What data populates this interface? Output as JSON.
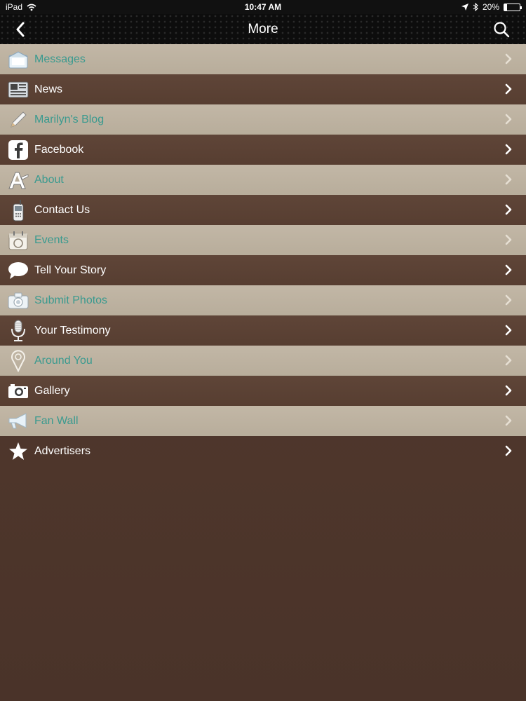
{
  "status_bar": {
    "device": "iPad",
    "time": "10:47 AM",
    "battery": "20%",
    "battery_level": 0.2
  },
  "nav": {
    "title": "More"
  },
  "menu": [
    {
      "label": "Messages",
      "icon": "envelope-icon"
    },
    {
      "label": "News",
      "icon": "newspaper-icon"
    },
    {
      "label": "Marilyn's Blog",
      "icon": "pencil-icon"
    },
    {
      "label": "Facebook",
      "icon": "facebook-icon"
    },
    {
      "label": "About",
      "icon": "about-icon"
    },
    {
      "label": "Contact Us",
      "icon": "phone-icon"
    },
    {
      "label": "Events",
      "icon": "calendar-icon"
    },
    {
      "label": "Tell Your Story",
      "icon": "speech-bubble-icon"
    },
    {
      "label": "Submit Photos",
      "icon": "camera-icon"
    },
    {
      "label": "Your Testimony",
      "icon": "microphone-icon"
    },
    {
      "label": "Around You",
      "icon": "location-pin-icon"
    },
    {
      "label": "Gallery",
      "icon": "gallery-camera-icon"
    },
    {
      "label": "Fan Wall",
      "icon": "megaphone-icon"
    },
    {
      "label": "Advertisers",
      "icon": "star-icon"
    }
  ],
  "colors": {
    "light_row": "#bcb09f",
    "dark_row": "#5b4135",
    "light_label": "#3a9a8f",
    "dark_label": "#ffffff",
    "background": "#4f372c"
  }
}
